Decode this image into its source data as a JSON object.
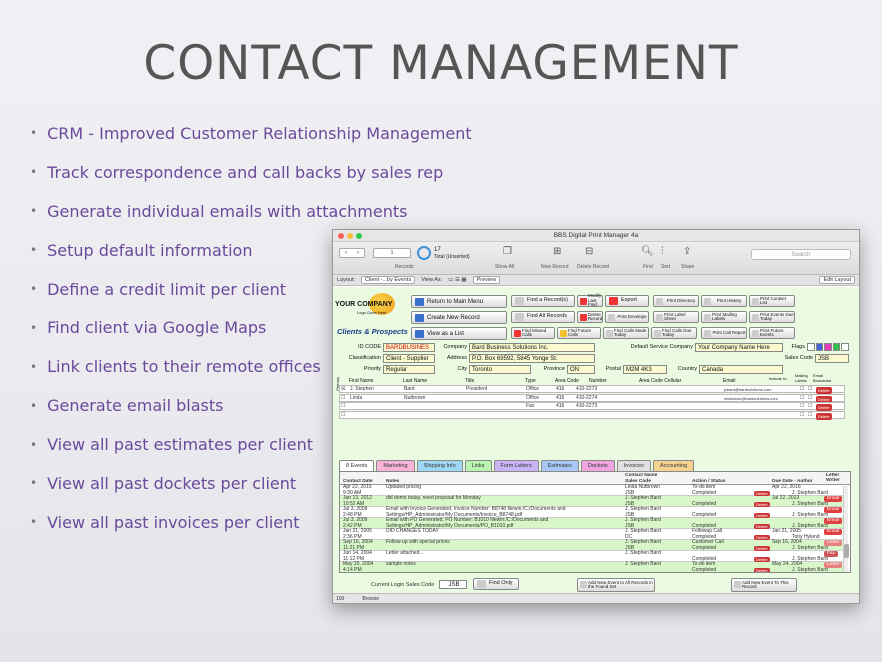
{
  "slide": {
    "title": "CONTACT MANAGEMENT",
    "bullets": [
      "CRM - Improved Customer Relationship Management",
      "Track correspondence and call backs by sales rep",
      "Generate individual emails with attachments",
      "Setup default information",
      "Define a credit limit per client",
      "Find client via Google Maps",
      "Link clients to their remote offices",
      "Generate email blasts",
      "View all past estimates per client",
      "View all past dockets per client",
      "View all past invoices per client"
    ]
  },
  "window": {
    "title": "BBS Digital Print Manager 4a",
    "toolbar": {
      "records_label": "Records",
      "record_number": "1",
      "total_count": "17",
      "total_label": "Total (Unsorted)",
      "show_all": "Show All",
      "new_record": "New Record",
      "delete_record": "Delete Record",
      "find": "Find",
      "sort": "Sort",
      "share": "Share",
      "search_placeholder": "Search"
    },
    "layout_bar": {
      "layout_label": "Layout:",
      "layout_value": "Client -...by Events",
      "view_as": "View As:",
      "preview": "Preview",
      "edit_layout": "Edit Layout"
    },
    "logo": {
      "name": "YOUR COMPANY",
      "tagline": "Logo Goes Here"
    },
    "section_title": "Clients & Prospects",
    "buttons": {
      "return_main": "Return to Main Menu",
      "create_new": "Create New Record",
      "view_list": "View as a List",
      "find_records": "Find a Record(s)",
      "modify_last_find": "Modify Last Find",
      "export": "Export",
      "find_all": "Find All Records",
      "delete_record": "Delete Record",
      "print_envelope": "Print Envelope",
      "find_missed_calls": "Find Missed Calls",
      "find_future_calls": "Find Future Calls",
      "find_calls_made_today": "Find Calls Made Today",
      "find_calls_due_today": "Find Calls Due Today",
      "print_directory": "Print Directory",
      "print_history": "Print History",
      "print_contact_list": "Print Contact List",
      "print_label_sheet": "Print Label Sheet",
      "print_mailing_labels": "Print Mailing Labels",
      "print_events_due_today": "Print Events Due Today",
      "print_call_report": "Print Call Report",
      "print_future_events": "Print Future Events"
    },
    "form": {
      "id_code_label": "ID CODE",
      "id_code": "BARDBUSINES",
      "company_label": "Company",
      "company": "Bard Business Solutions Inc.",
      "default_service_label": "Default Service Company",
      "default_service": "Your Company Name Here",
      "flags_label": "Flags",
      "classification_label": "Classification",
      "classification": "Client - Supplier",
      "address_label": "Address",
      "address": "P.O. Box 69592, 5845 Yonge St.",
      "sales_code_label": "Sales Code",
      "sales_code": "JSB",
      "priority_label": "Priority",
      "priority": "Regular",
      "city_label": "City",
      "city": "Toronto",
      "province_label": "Province",
      "province": "ON",
      "postal_label": "Postal",
      "postal": "M2M 4K3",
      "country_label": "Country",
      "country": "Canada"
    },
    "contact_headers": {
      "primary": "Primary",
      "first": "First Name",
      "last": "Last Name",
      "title": "Title",
      "type": "Type",
      "area_code": "Area Code",
      "number": "Number",
      "area_code_cellular": "Area Code Cellular",
      "email": "Email",
      "include_in": "Include In:",
      "mailing_labels": "Mailing Labels",
      "email_broadcast": "Email Broadcast"
    },
    "contacts": [
      {
        "check": "☒",
        "first": "J. Stephen",
        "last": "Bard",
        "title": "President",
        "type": "Office",
        "area": "416",
        "number": "410-2273",
        "email": "jsbard@bardsolutions.com",
        "del": "Delete"
      },
      {
        "check": "☐",
        "first": "Linda",
        "last": "Nutbrown",
        "title": "",
        "type": "Office",
        "area": "416",
        "number": "410-2274",
        "email": "lnutbrown@bardsolutions.com",
        "del": "Delete"
      },
      {
        "check": "☐",
        "first": "",
        "last": "",
        "title": "",
        "type": "Fax",
        "area": "416",
        "number": "410-2273",
        "email": "",
        "del": "Delete"
      },
      {
        "check": "☐",
        "first": "",
        "last": "",
        "title": "",
        "type": "",
        "area": "",
        "number": "",
        "email": "",
        "del": "Delete"
      }
    ],
    "tabs": [
      {
        "label": "8 Events",
        "color": "#ffffff"
      },
      {
        "label": "Marketing",
        "color": "#f7b4d8"
      },
      {
        "label": "Shipping Info",
        "color": "#9fd8f5"
      },
      {
        "label": "Links",
        "color": "#b9f5b0"
      },
      {
        "label": "Form Letters",
        "color": "#c9b4f5"
      },
      {
        "label": "Estimates",
        "color": "#a8c8f5"
      },
      {
        "label": "Dockets",
        "color": "#f0a5e0"
      },
      {
        "label": "Invoices",
        "color": "#e0e0e0"
      },
      {
        "label": "Accounting",
        "color": "#f5d290"
      }
    ],
    "event_headers": {
      "contact_date": "Contact Date",
      "notes": "Notes",
      "contact_name": "Contact Name",
      "sales_code": "Sales Code",
      "action_status": "Action / Status",
      "due_date_author": "Due Date - Author",
      "letter_writer": "Letter Writer"
    },
    "events": [
      {
        "date": "Apr 22, 2016",
        "time": "9:30 AM",
        "note1": "Updated pricing",
        "note2": "",
        "contact": "Linda Nutbrown",
        "code": "JSB",
        "action": "To-do item",
        "status": "Completed",
        "due": "Apr 22, 2016",
        "author": "J. Stephen Bard",
        "tag": "",
        "green": false
      },
      {
        "date": "Jan 13, 2012",
        "time": "10:52 AM",
        "note1": "did demo today, need proposal for Monday",
        "note2": "",
        "contact": "J. Stephen Bard",
        "code": "JSB",
        "action": "",
        "status": "Completed",
        "due": "Jul 22, 2013",
        "author": "J. Stephen Bard",
        "tag": "Email",
        "green": true
      },
      {
        "date": "Jul 3, 2009",
        "time": "2:48 PM",
        "note1": "Email with Invoice Generated, Invoice Number: B8748  filewin:/C:/Documents and",
        "note2": "Settings/HP_Administrator/My Documents/Invoice_B8748.pdf",
        "contact": "J. Stephen Bard",
        "code": "JSB",
        "action": "",
        "status": "Completed",
        "due": "",
        "author": "J. Stephen Bard",
        "tag": "Email",
        "green": false
      },
      {
        "date": "Jul 3, 2009",
        "time": "2:42 PM",
        "note1": "Email with PO Generated, PO Number: B1010  filewin:/C:/Documents and",
        "note2": "Settings/HP_Administrator/My Documents/PO_B1010.pdf",
        "contact": "J. Stephen Bard",
        "code": "JSB",
        "action": "",
        "status": "Completed",
        "due": "",
        "author": "J. Stephen Bard",
        "tag": "Email",
        "green": true
      },
      {
        "date": "Jan 21, 2005",
        "time": "2:36 PM",
        "note1": "DID CHANGES TODAY",
        "note2": "",
        "contact": "J. Stephen Bard",
        "code": "DC",
        "action": "Followup Call",
        "status": "Completed",
        "due": "Jan 21, 2005",
        "author": "Tony Hyland",
        "tag": "Email",
        "green": false
      },
      {
        "date": "Sep 16, 2004",
        "time": "11:21 PM",
        "note1": "Follow-up with special prices",
        "note2": "",
        "contact": "J. Stephen Bard",
        "code": "JSB",
        "action": "Customer Call",
        "status": "Completed",
        "due": "Sep 16, 2004",
        "author": "J. Stephen Bard",
        "tag": "Letter",
        "green": true
      },
      {
        "date": "Jun 14, 2004",
        "time": "11:12 PM",
        "note1": "Letter attached...",
        "note2": "",
        "contact": "J. Stephen Bard",
        "code": "",
        "action": "",
        "status": "Completed",
        "due": "",
        "author": "J. Stephen Bard",
        "tag": "Fax",
        "green": false
      },
      {
        "date": "May 20, 2004",
        "time": "4:14 PM",
        "note1": "sample notes",
        "note2": "",
        "contact": "J. Stephen Bard",
        "code": "",
        "action": "To-do item",
        "status": "Completed",
        "due": "May 24, 2004",
        "author": "J. Stephen Bard",
        "tag": "Letter",
        "green": true
      }
    ],
    "bottom": {
      "login_label": "Current Login Sales Code",
      "login_code": "JSB",
      "find_only": "Find Only",
      "add_event_all": "Add New Event to All Records in the Found Set",
      "add_event_this": "Add New Event To This Record"
    },
    "status": {
      "zoom": "100",
      "mode": "Browse"
    }
  }
}
